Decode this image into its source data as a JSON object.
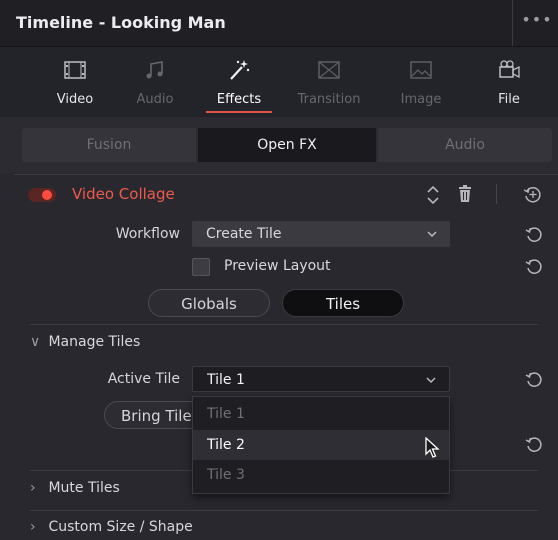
{
  "window": {
    "title": "Timeline - Looking Man",
    "more_icon": "ellipsis-icon"
  },
  "tabs": [
    {
      "label": "Video",
      "icon": "filmstrip-icon",
      "state": "enabled"
    },
    {
      "label": "Audio",
      "icon": "music-note-icon",
      "state": "disabled"
    },
    {
      "label": "Effects",
      "icon": "magic-wand-icon",
      "state": "active"
    },
    {
      "label": "Transition",
      "icon": "transition-icon",
      "state": "disabled"
    },
    {
      "label": "Image",
      "icon": "image-icon",
      "state": "disabled"
    },
    {
      "label": "File",
      "icon": "film-camera-icon",
      "state": "enabled"
    }
  ],
  "subtabs": [
    {
      "label": "Fusion",
      "state": "inactive"
    },
    {
      "label": "Open FX",
      "state": "active"
    },
    {
      "label": "Audio",
      "state": "inactive"
    }
  ],
  "effect": {
    "name": "Video Collage",
    "enabled": true,
    "workflow_label": "Workflow",
    "workflow_value": "Create Tile",
    "preview_layout_label": "Preview Layout",
    "preview_layout_checked": false,
    "mode_buttons": [
      "Globals",
      "Tiles"
    ],
    "selected_mode": "Tiles"
  },
  "manage_tiles": {
    "header": "Manage Tiles",
    "active_tile_label": "Active Tile",
    "active_tile_value": "Tile 1",
    "bring_button_label": "Bring Tile",
    "dropdown_options": [
      "Tile 1",
      "Tile 2",
      "Tile 3"
    ],
    "highlighted_option": "Tile 2"
  },
  "sections": [
    {
      "label": "Mute Tiles",
      "expanded": false
    },
    {
      "label": "Custom Size / Shape",
      "expanded": false
    }
  ],
  "colors": {
    "accent": "#e2544a",
    "effect_name": "#ef5a4c",
    "toggle_knob": "#ff4b3e"
  }
}
